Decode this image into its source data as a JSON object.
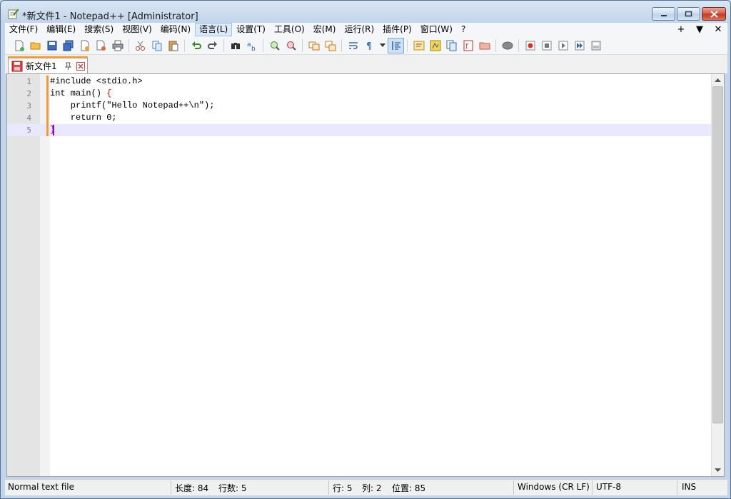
{
  "window": {
    "title": "*新文件1 - Notepad++ [Administrator]"
  },
  "menu": {
    "items": [
      "文件(F)",
      "编辑(E)",
      "搜索(S)",
      "视图(V)",
      "编码(N)",
      "语言(L)",
      "设置(T)",
      "工具(O)",
      "宏(M)",
      "运行(R)",
      "插件(P)",
      "窗口(W)",
      "?"
    ],
    "active_index": 5,
    "right": [
      "+",
      "▼",
      "✕"
    ]
  },
  "tab": {
    "label": "新文件1"
  },
  "editor": {
    "lines": [
      {
        "num": "1",
        "text": "#include <stdio.h>"
      },
      {
        "num": "2",
        "text": "int main() ",
        "brace": "{"
      },
      {
        "num": "3",
        "text": "    printf(\"Hello Notepad++\\n\");"
      },
      {
        "num": "4",
        "text": "    return 0;"
      },
      {
        "num": "5",
        "text": "",
        "brace": "}"
      }
    ],
    "current_line": 5
  },
  "status": {
    "file_type": "Normal text file",
    "length": "长度: 84",
    "lines": "行数: 5",
    "row": "行: 5",
    "col": "列: 2",
    "pos": "位置: 85",
    "eol": "Windows (CR LF)",
    "encoding": "UTF-8",
    "mode": "INS"
  },
  "colors": {
    "change_mark": "#f29a38",
    "current_line_bg": "#e8e8ff",
    "brace": "#ff0000",
    "caret": "#8000ff"
  }
}
